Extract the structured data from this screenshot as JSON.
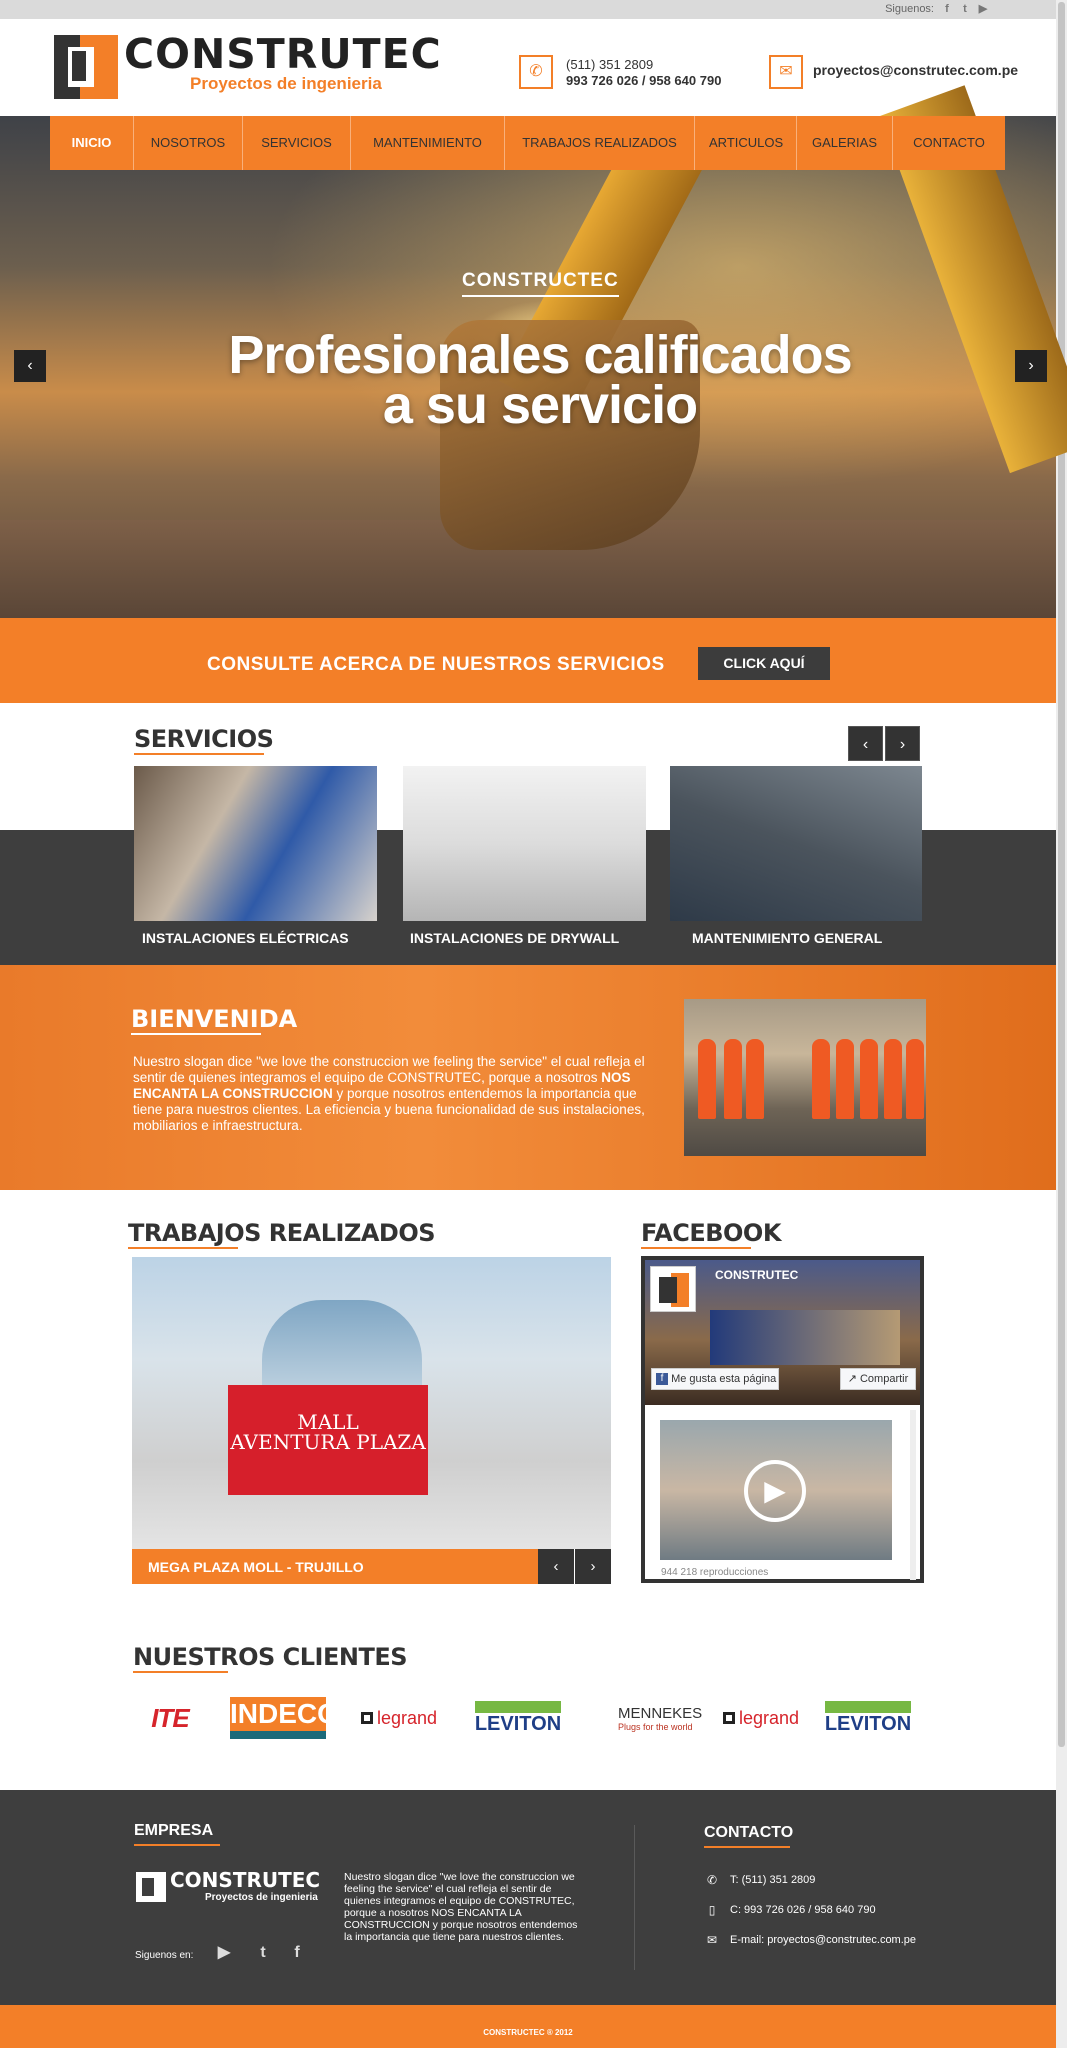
{
  "topbar": {
    "follow_label": "Siguenos:",
    "icons": [
      "facebook-icon",
      "twitter-icon",
      "youtube-icon"
    ]
  },
  "header": {
    "brand": "CONSTRUTEC",
    "tagline": "Proyectos de ingenieria",
    "phone_line1": "(511) 351 2809",
    "phone_line2": "993 726 026 / 958 640 790",
    "email": "proyectos@construtec.com.pe"
  },
  "nav": {
    "items": [
      "INICIO",
      "NOSOTROS",
      "SERVICIOS",
      "MANTENIMIENTO",
      "TRABAJOS REALIZADOS",
      "ARTICULOS",
      "GALERIAS",
      "CONTACTO"
    ],
    "active": "INICIO"
  },
  "hero": {
    "kicker": "CONSTRUCTEC",
    "title_line1": "Profesionales calificados",
    "title_line2": "a su servicio"
  },
  "consult": {
    "text": "CONSULTE ACERCA DE NUESTROS SERVICIOS",
    "button": "CLICK AQUÍ"
  },
  "services": {
    "title": "SERVICIOS",
    "items": [
      {
        "caption": "INSTALACIONES ELÉCTRICAS"
      },
      {
        "caption": "INSTALACIONES DE DRYWALL"
      },
      {
        "caption": "MANTENIMIENTO GENERAL"
      }
    ]
  },
  "welcome": {
    "title": "BIENVENIDA",
    "text_1": "Nuestro slogan dice \"we love the construccion we feeling the service\" el cual refleja el sentir de quienes integramos el equipo de CONSTRUTEC, porque a nosotros ",
    "text_bold": "NOS ENCANTA LA CONSTRUCCION",
    "text_2": " y porque nosotros entendemos la importancia que tiene para nuestros clientes. La eficiencia y buena funcionalidad de sus instalaciones, mobiliarios e infraestructura."
  },
  "works": {
    "title": "TRABAJOS REALIZADOS",
    "image_sign_1": "MALL",
    "image_sign_2": "AVENTURA PLAZA",
    "caption": "MEGA PLAZA MOLL - TRUJILLO"
  },
  "facebook": {
    "title": "FACEBOOK",
    "page_name": "CONSTRUTEC",
    "like_label": "Me gusta esta página",
    "share_label": "Compartir",
    "views": "944 218 reproducciones"
  },
  "clients": {
    "title": "NUESTROS CLIENTES",
    "logos": [
      "ITE",
      "INDECO",
      "legrand",
      "LEVITON",
      "MENNEKES",
      "legrand",
      "LEVITON"
    ],
    "mennekes_sub": "Plugs for the world"
  },
  "footer": {
    "empresa_title": "EMPRESA",
    "brand": "CONSTRUTEC",
    "tagline": "Proyectos de ingenieria",
    "text": "Nuestro slogan dice \"we love the construccion we feeling the service\" el cual refleja el sentir de quienes integramos el equipo de CONSTRUTEC, porque a nosotros NOS ENCANTA LA CONSTRUCCION y porque nosotros entendemos la importancia que tiene para nuestros clientes.",
    "follow_label": "Siguenos en:",
    "contact_title": "CONTACTO",
    "phone": "T: (511) 351 2809",
    "cell": "C: 993 726 026 / 958 640 790",
    "email": "E-mail: proyectos@construtec.com.pe"
  },
  "copyright": "CONSTRUCTEC ® 2012",
  "colors": {
    "accent": "#f37f28",
    "dark": "#3e3e3e"
  }
}
